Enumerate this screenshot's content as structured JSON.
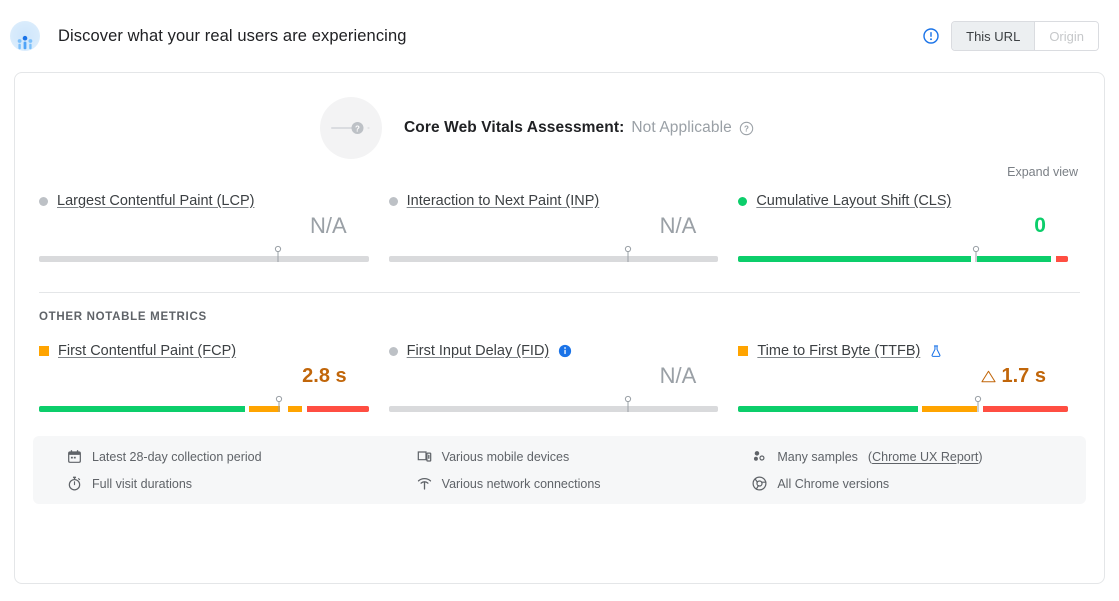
{
  "header": {
    "icon": "real-user-monitoring-icon",
    "title": "Discover what your real users are experiencing",
    "alert_icon": "alert-circle-icon",
    "toggle": {
      "options": [
        "This URL",
        "Origin"
      ],
      "selected": "This URL"
    }
  },
  "assessment": {
    "label": "Core Web Vitals Assessment:",
    "value": "Not Applicable",
    "help_icon": "help-circle-icon",
    "gauge_icon": "unknown-gauge-icon"
  },
  "expand_view": "Expand view",
  "core_metrics": [
    {
      "marker": "dot-gray",
      "name": "Largest Contentful Paint (LCP)",
      "value": "N/A",
      "value_state": "na",
      "badge": null,
      "bar": {
        "segments": [
          {
            "color": "#d9dadc",
            "pct": 100
          }
        ],
        "pin_pct": 72.5
      }
    },
    {
      "marker": "dot-gray",
      "name": "Interaction to Next Paint (INP)",
      "value": "N/A",
      "value_state": "na",
      "badge": null,
      "bar": {
        "segments": [
          {
            "color": "#d9dadc",
            "pct": 100
          }
        ],
        "pin_pct": 72.5
      }
    },
    {
      "marker": "dot-green",
      "name": "Cumulative Layout Shift (CLS)",
      "value": "0",
      "value_state": "good",
      "badge": null,
      "bar": {
        "segments": [
          {
            "color": "#0cce6b",
            "pct": 70.5
          },
          {
            "color": "#ffffff",
            "pct": 1.8
          },
          {
            "color": "#0cce6b",
            "pct": 22.7
          },
          {
            "color": "#ffffff",
            "pct": 1.5
          },
          {
            "color": "#ff4e42",
            "pct": 3.5
          }
        ],
        "pin_pct": 72.0
      }
    }
  ],
  "other_section_title": "OTHER NOTABLE METRICS",
  "other_metrics": [
    {
      "marker": "square-orange",
      "name": "First Contentful Paint (FCP)",
      "value": "2.8 s",
      "value_state": "needs-improvement",
      "badge": null,
      "warn": false,
      "bar": {
        "segments": [
          {
            "color": "#0cce6b",
            "pct": 62.5
          },
          {
            "color": "#ffffff",
            "pct": 1.2
          },
          {
            "color": "#ffa400",
            "pct": 9.5
          },
          {
            "color": "#ffffff",
            "pct": 2.2
          },
          {
            "color": "#ffa400",
            "pct": 4.5
          },
          {
            "color": "#ffffff",
            "pct": 1.5
          },
          {
            "color": "#ff4e42",
            "pct": 18.6
          }
        ],
        "pin_pct": 72.8
      }
    },
    {
      "marker": "dot-gray",
      "name": "First Input Delay (FID)",
      "value": "N/A",
      "value_state": "na",
      "badge": "info-icon",
      "warn": false,
      "bar": {
        "segments": [
          {
            "color": "#d9dadc",
            "pct": 100
          }
        ],
        "pin_pct": 72.5
      }
    },
    {
      "marker": "square-orange",
      "name": "Time to First Byte (TTFB)",
      "value": "1.7 s",
      "value_state": "needs-improvement",
      "badge": "experiment-flask-icon",
      "warn": true,
      "warn_icon": "warning-triangle-icon",
      "bar": {
        "segments": [
          {
            "color": "#0cce6b",
            "pct": 54.5
          },
          {
            "color": "#ffffff",
            "pct": 1.2
          },
          {
            "color": "#ffa400",
            "pct": 16.8
          },
          {
            "color": "#ffffff",
            "pct": 1.8
          },
          {
            "color": "#ff4e42",
            "pct": 25.7
          }
        ],
        "pin_pct": 72.8
      }
    }
  ],
  "footer": [
    {
      "icon": "calendar-icon",
      "text": "Latest 28-day collection period",
      "link": null
    },
    {
      "icon": "devices-icon",
      "text": "Various mobile devices",
      "link": null
    },
    {
      "icon": "samples-icon",
      "text": "Many samples",
      "link": "Chrome UX Report",
      "link_wrap": [
        "(",
        ")"
      ]
    },
    {
      "icon": "stopwatch-icon",
      "text": "Full visit durations",
      "link": null
    },
    {
      "icon": "wifi-icon",
      "text": "Various network connections",
      "link": null
    },
    {
      "icon": "chrome-icon",
      "text": "All Chrome versions",
      "link": null
    }
  ],
  "colors": {
    "good": "#0cce6b",
    "needs_improvement": "#ffa400",
    "poor": "#ff4e42",
    "neutral": "#d9dadc",
    "link_blue": "#1a73e8"
  }
}
